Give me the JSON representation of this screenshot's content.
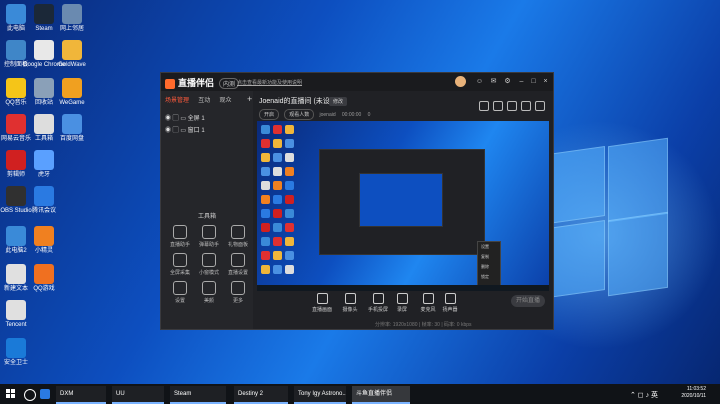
{
  "desktop": {
    "icons": [
      {
        "label": "此电脑",
        "color": "#3a8ad8"
      },
      {
        "label": "Steam",
        "color": "#1b2838"
      },
      {
        "label": "网上邻居",
        "color": "#6a8ab0"
      },
      {
        "label": "控制面板",
        "color": "#3f86c8"
      },
      {
        "label": "Google Chrome",
        "color": "#e8e8e8"
      },
      {
        "label": "GoldWave",
        "color": "#f0b63a"
      },
      {
        "label": "QQ音乐",
        "color": "#f5c518"
      },
      {
        "label": "回收站",
        "color": "#8aa0b8"
      },
      {
        "label": "WeGame",
        "color": "#f0a020"
      },
      {
        "label": "网易云音乐",
        "color": "#e03030"
      },
      {
        "label": "工具箱",
        "color": "#ddd"
      },
      {
        "label": "百度网盘",
        "color": "#4a90e2"
      },
      {
        "label": "剪辑师",
        "color": "#d02020"
      },
      {
        "label": "虎牙",
        "color": "#5aa0ff"
      },
      {
        "label": "OBS Studio",
        "color": "#303030"
      },
      {
        "label": "腾讯会议",
        "color": "#2a7ae2"
      },
      {
        "label": "此电脑2",
        "color": "#3a8ad8"
      },
      {
        "label": "小精灵",
        "color": "#f08020"
      },
      {
        "label": "新建文本",
        "color": "#e0e0e0"
      },
      {
        "label": "QQ游戏",
        "color": "#f07020"
      },
      {
        "label": "Tencent",
        "color": "#e0e0e0"
      },
      {
        "label": "安全卫士",
        "color": "#1a7ad8"
      }
    ]
  },
  "app": {
    "brand": "直播伴侣",
    "version": "内测",
    "notice": "点击查看最新功能及使用说明",
    "left_tabs": [
      {
        "label": "场景管理",
        "active": true
      },
      {
        "label": "互动",
        "active": false
      },
      {
        "label": "观众",
        "active": false
      }
    ],
    "scenes": [
      "全屏 1",
      "窗口 1"
    ],
    "tools_title": "工具箱",
    "tools": [
      "直播助手",
      "弹幕助手",
      "礼物面板",
      "全屏采集",
      "小窗模式",
      "直播设置",
      "设置",
      "美颜",
      "更多"
    ],
    "stream_title": "Joenaid的直播间 (未设定)",
    "stream_tag": "修改",
    "meta": {
      "pill1": "开启",
      "pill2": "观看人数",
      "id": "joenaid",
      "time": "00:00:00",
      "viewers": "0"
    },
    "preview_menu": [
      "设置",
      "复制",
      "删除",
      "锁定"
    ],
    "controls": [
      "直播画面",
      "摄像头",
      "手机投屏",
      "录屏",
      "麦克风",
      "扬声器"
    ],
    "go_live": "开始直播",
    "status": {
      "left": "分辨率: 1920x1080 | 帧率: 30 | 码率: 0 kbps",
      "right": "CPU: 12% | 内存: 45% | 丢帧: 0"
    }
  },
  "taskbar": {
    "apps": [
      {
        "label": "DXM",
        "active": false
      },
      {
        "label": "UU",
        "active": false
      },
      {
        "label": "Steam",
        "active": false
      },
      {
        "label": "Destiny 2",
        "active": false
      },
      {
        "label": "Tony Igy Astrono...",
        "active": false
      },
      {
        "label": "斗鱼直播伴侣",
        "active": true
      }
    ],
    "time": "11:03:52",
    "date": "2020/10/11"
  }
}
